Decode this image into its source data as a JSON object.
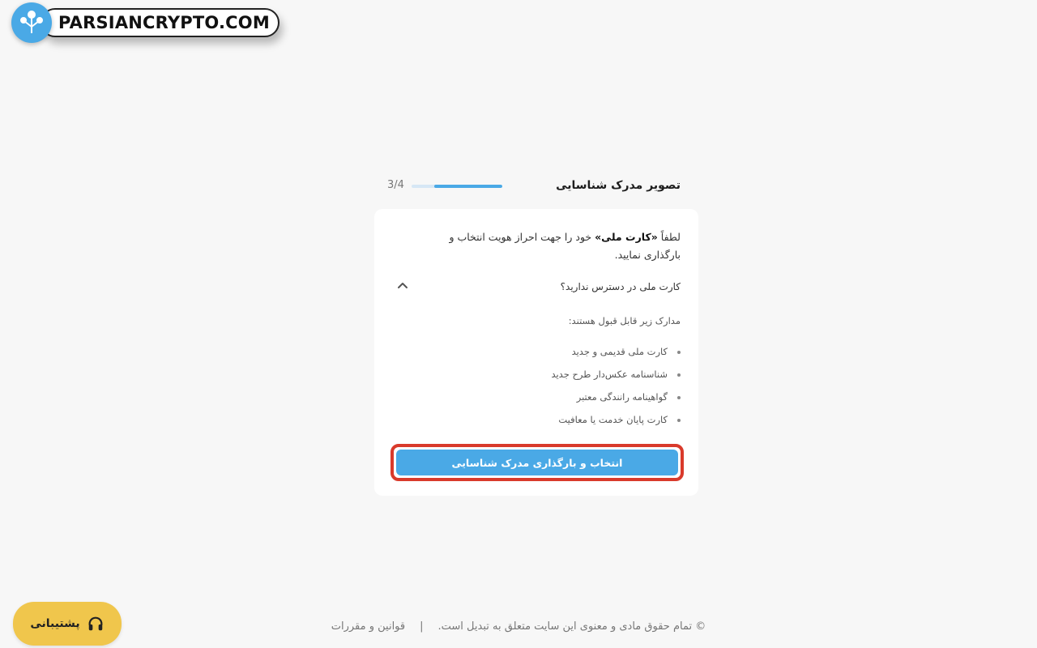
{
  "watermark": {
    "text": "PARSIANCRYPTO.COM"
  },
  "step": {
    "title": "تصویر مدرک شناسایی",
    "counter": "3/4",
    "progress_fraction": 0.75
  },
  "card": {
    "intro_prefix": "لطفاً ",
    "intro_bold": "«کارت ملی»",
    "intro_suffix": " خود را جهت احراز هویت انتخاب و بارگذاری نمایید.",
    "accordion_title": "کارت ملی در دسترس ندارید؟",
    "accepted_heading": "مدارک زیر قابل قبول هستند:",
    "accepted_docs": [
      "کارت ملی قدیمی و جدید",
      "شناسنامه عکس‌دار طرح جدید",
      "گواهینامه رانندگی معتبر",
      "کارت پایان خدمت یا معافیت"
    ],
    "upload_button": "انتخاب و بارگذاری مدرک شناسایی"
  },
  "support": {
    "label": "پشتیبانی",
    "icon": "headphones-icon"
  },
  "footer": {
    "copyright": "© تمام حقوق مادی و معنوی این سایت متعلق به تبدیل است.",
    "separator": "|",
    "terms_link": "قوانین و مقررات"
  },
  "colors": {
    "accent": "#4aa9e6",
    "highlight": "#d93a2b",
    "support_bg": "#f0c64c",
    "page_bg": "#f7f7f7"
  }
}
